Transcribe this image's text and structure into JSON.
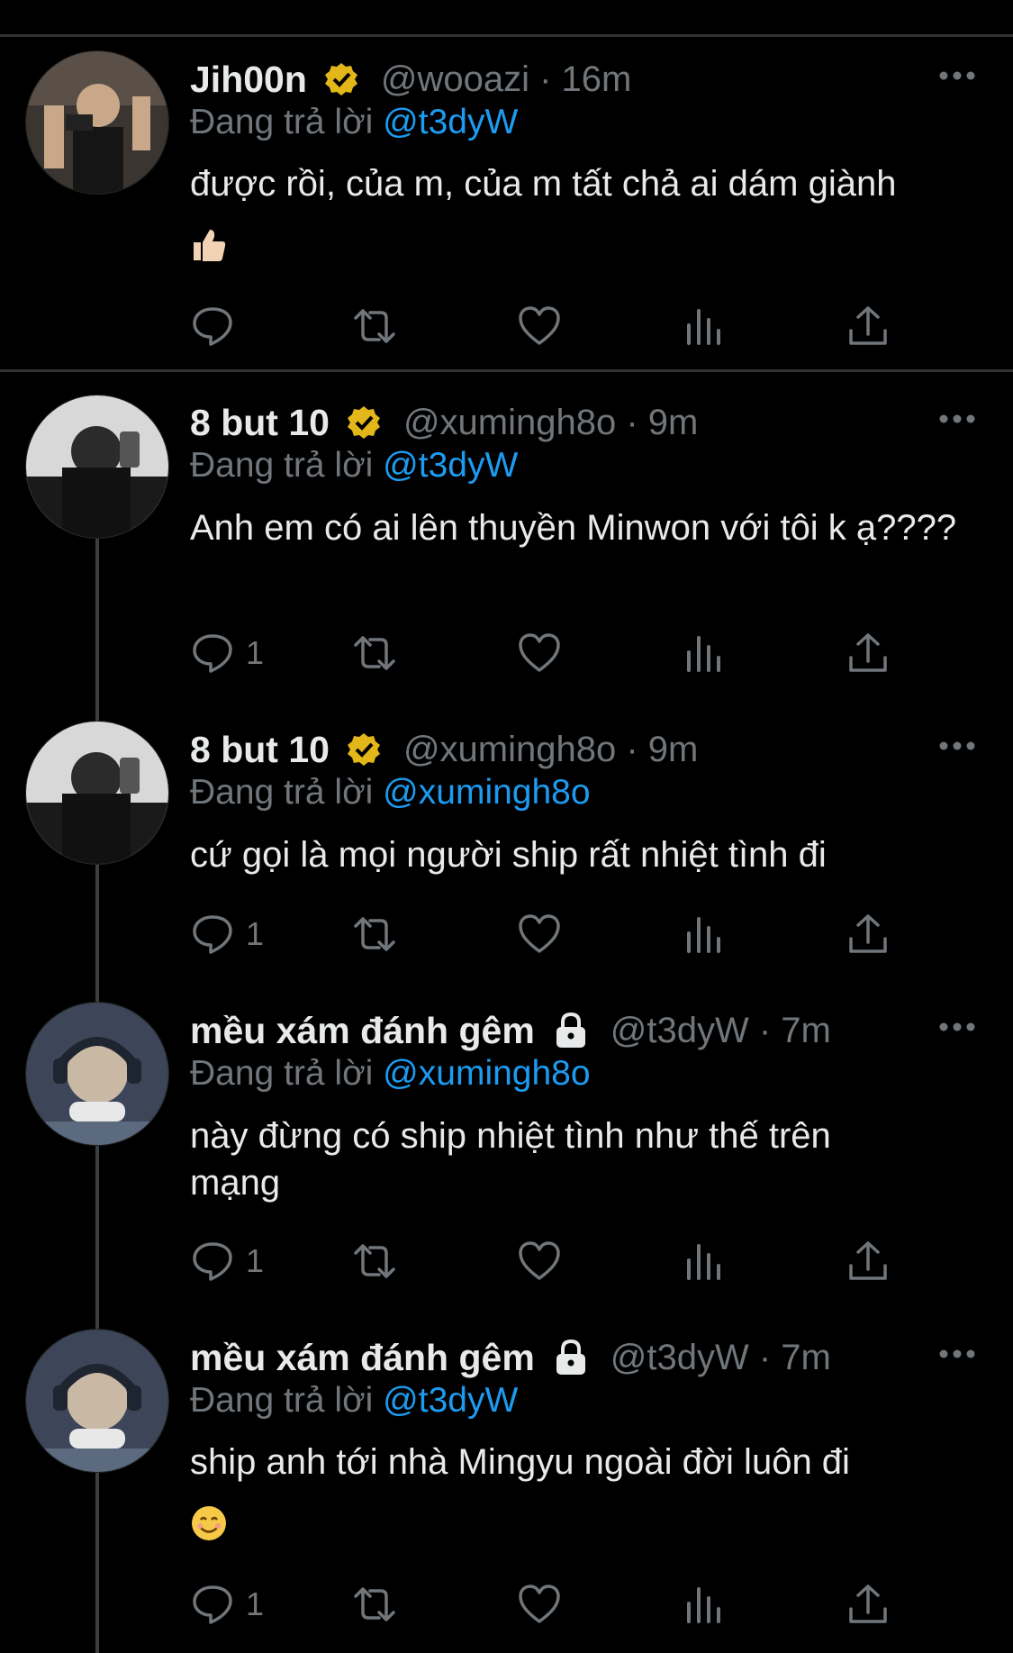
{
  "replying_prefix": "Đang trả lời",
  "colors": {
    "background": "#000000",
    "text": "#e7e9ea",
    "muted": "#71767b",
    "link": "#1d9bf0",
    "verified": "#e2b719"
  },
  "tweets": [
    {
      "name": "Jih00n",
      "badge": "verified-gold-icon",
      "handle": "@wooazi · 16m",
      "replying_to": "@t3dyW",
      "text": "được rồi, của m, của m tất chả ai dám giành",
      "emoji": "thumbs-up-emoji",
      "reply_count": ""
    },
    {
      "name": "8 but 10",
      "badge": "verified-gold-icon",
      "handle": "@xumingh8o · 9m",
      "replying_to": "@t3dyW",
      "text": "Anh em có ai lên thuyền Minwon với tôi k ạ????",
      "reply_count": "1"
    },
    {
      "name": "8 but 10",
      "badge": "verified-gold-icon",
      "handle": "@xumingh8o · 9m",
      "replying_to": "@xumingh8o",
      "text": "cứ gọi là mọi người ship rất nhiệt tình đi",
      "reply_count": "1"
    },
    {
      "name": "mều xám đánh gêm",
      "badge": "lock-icon",
      "handle": "@t3dyW · 7m",
      "replying_to": "@xumingh8o",
      "text": "này đừng có ship nhiệt tình như thế trên mạng",
      "reply_count": "1"
    },
    {
      "name": "mều xám đánh gêm",
      "badge": "lock-icon",
      "handle": "@t3dyW · 7m",
      "replying_to": "@t3dyW",
      "text": "ship anh tới nhà Mingyu ngoài đời luôn đi",
      "emoji": "smiling-face-emoji",
      "reply_count": "1"
    }
  ]
}
